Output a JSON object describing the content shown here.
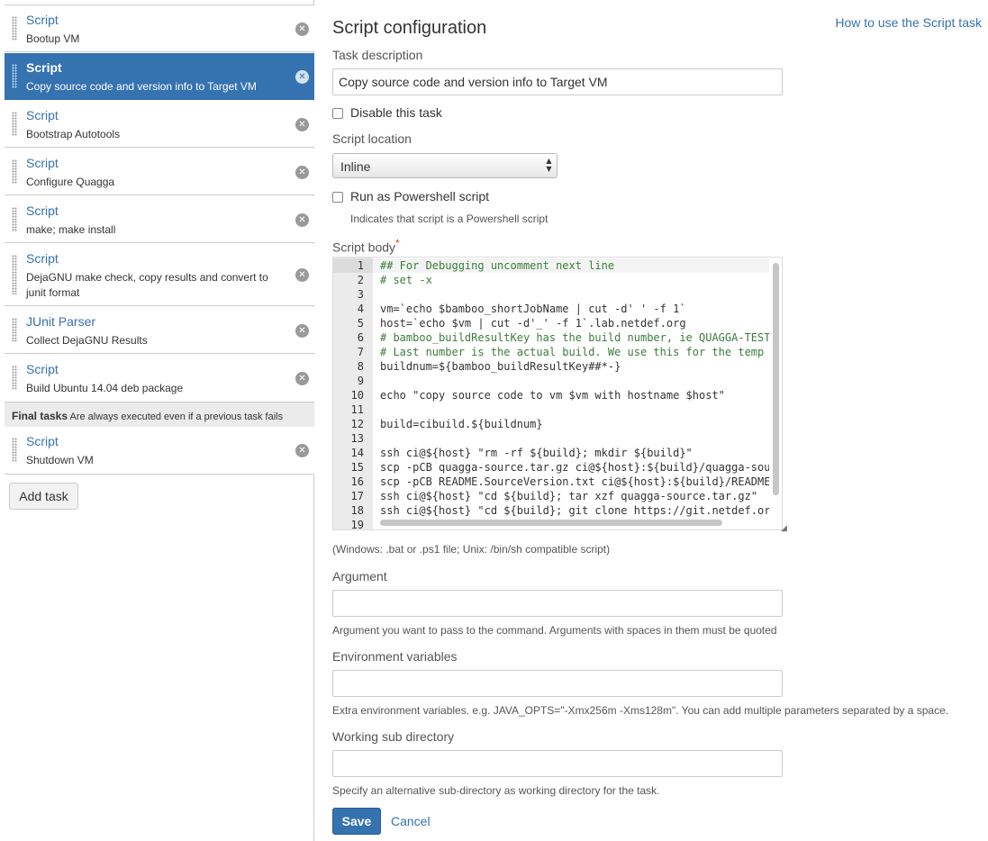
{
  "sidebar": {
    "tasks": [
      {
        "title": "Script",
        "desc": "Bootup VM"
      },
      {
        "title": "Script",
        "desc": "Copy source code and version info to Target VM"
      },
      {
        "title": "Script",
        "desc": "Bootstrap Autotools"
      },
      {
        "title": "Script",
        "desc": "Configure Quagga"
      },
      {
        "title": "Script",
        "desc": "make; make install"
      },
      {
        "title": "Script",
        "desc": "DejaGNU make check, copy results and convert to junit format"
      },
      {
        "title": "JUnit Parser",
        "desc": "Collect DejaGNU Results"
      },
      {
        "title": "Script",
        "desc": "Build Ubuntu 14.04 deb package"
      }
    ],
    "final_tasks_title": "Final tasks",
    "final_tasks_note": "Are always executed even if a previous task fails",
    "final_tasks": [
      {
        "title": "Script",
        "desc": "Shutdown VM"
      }
    ],
    "add_task_label": "Add task",
    "delete_glyph": "✕"
  },
  "main": {
    "title": "Script configuration",
    "help_link": "How to use the Script task",
    "task_description": {
      "label": "Task description",
      "value": "Copy source code and version info to Target VM"
    },
    "disable_task_label": "Disable this task",
    "script_location": {
      "label": "Script location",
      "value": "Inline"
    },
    "powershell": {
      "label": "Run as Powershell script",
      "help": "Indicates that script is a Powershell script"
    },
    "script_body": {
      "label": "Script body",
      "required_mark": "*",
      "help": "(Windows: .bat or .ps1 file; Unix: /bin/sh compatible script)",
      "line_numbers": [
        "1",
        "2",
        "3",
        "4",
        "5",
        "6",
        "7",
        "8",
        "9",
        "10",
        "11",
        "12",
        "13",
        "14",
        "15",
        "16",
        "17",
        "18",
        "19"
      ],
      "lines": [
        "## For Debugging uncomment next line",
        "# set -x",
        "",
        "vm=`echo $bamboo_shortJobName | cut -d' ' -f 1`",
        "host=`echo $vm | cut -d'_' -f 1`.lab.netdef.org",
        "# bamboo_buildResultKey has the build number, ie QUAGGA-TEST",
        "# Last number is the actual build. We use this for the temp",
        "buildnum=${bamboo_buildResultKey##*-}",
        "",
        "echo \"copy source code to vm $vm with hostname $host\"",
        "",
        "build=cibuild.${buildnum}",
        "",
        "ssh ci@${host} \"rm -rf ${build}; mkdir ${build}\"",
        "scp -pCB quagga-source.tar.gz ci@${host}:${build}/quagga-sou",
        "scp -pCB README.SourceVersion.txt ci@${host}:${build}/README",
        "ssh ci@${host} \"cd ${build}; tar xzf quagga-source.tar.gz\"",
        "ssh ci@${host} \"cd ${build}; git clone https://git.netdef.or",
        ""
      ]
    },
    "argument": {
      "label": "Argument",
      "value": "",
      "help": "Argument you want to pass to the command. Arguments with spaces in them must be quoted"
    },
    "env_vars": {
      "label": "Environment variables",
      "value": "",
      "help": "Extra environment variables. e.g. JAVA_OPTS=\"-Xmx256m -Xms128m\". You can add multiple parameters separated by a space."
    },
    "working_dir": {
      "label": "Working sub directory",
      "value": "",
      "help": "Specify an alternative sub-directory as working directory for the task."
    },
    "save_label": "Save",
    "cancel_label": "Cancel"
  },
  "colors": {
    "accent": "#3572b0",
    "required": "#d04437"
  },
  "icons": [
    "grip-handle-icon",
    "delete-circle-icon",
    "select-arrows-icon",
    "resize-handle-icon"
  ]
}
